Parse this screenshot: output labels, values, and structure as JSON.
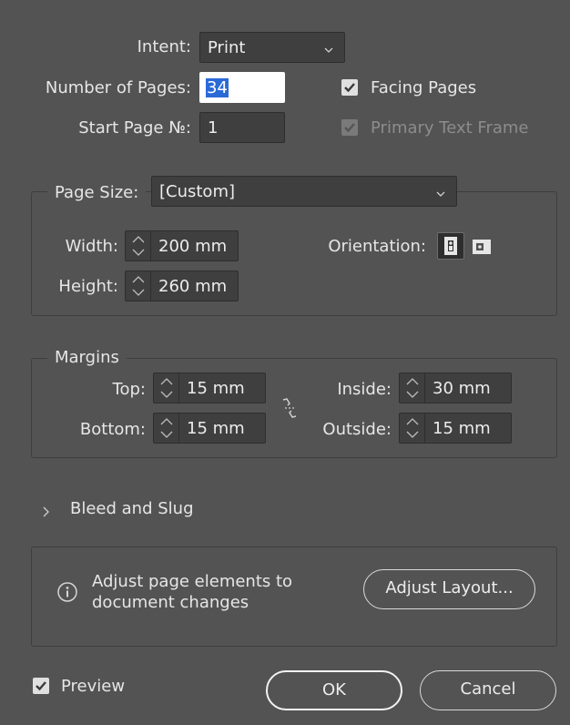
{
  "intent": {
    "label": "Intent:",
    "value": "Print"
  },
  "pages": {
    "label": "Number of Pages:",
    "value": "34"
  },
  "start_page": {
    "label": "Start Page №:",
    "value": "1"
  },
  "facing_pages": {
    "label": "Facing Pages",
    "checked": true
  },
  "primary_text_frame": {
    "label": "Primary Text Frame",
    "checked": true,
    "enabled": false
  },
  "page_size": {
    "label": "Page Size:",
    "value": "[Custom]",
    "width_label": "Width:",
    "width": "200 mm",
    "height_label": "Height:",
    "height": "260 mm",
    "orientation_label": "Orientation:"
  },
  "margins": {
    "title": "Margins",
    "top_label": "Top:",
    "top": "15 mm",
    "bottom_label": "Bottom:",
    "bottom": "15 mm",
    "inside_label": "Inside:",
    "inside": "30 mm",
    "outside_label": "Outside:",
    "outside": "15 mm"
  },
  "bleed_slug": {
    "label": "Bleed and Slug"
  },
  "adjust": {
    "info_line1": "Adjust page elements to",
    "info_line2": "document changes",
    "button": "Adjust Layout..."
  },
  "preview": {
    "label": "Preview",
    "checked": true
  },
  "buttons": {
    "ok": "OK",
    "cancel": "Cancel"
  },
  "colors": {
    "background": "#535353",
    "field": "#3f3f3f",
    "selection": "#2a6ad7"
  }
}
